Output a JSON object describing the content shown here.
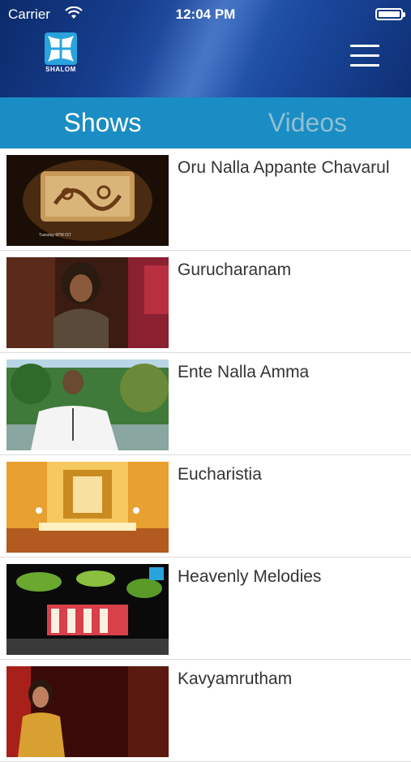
{
  "status_bar": {
    "carrier": "Carrier",
    "time": "12:04 PM"
  },
  "header": {
    "logo_text": "SHALOM"
  },
  "tabs": [
    {
      "label": "Shows",
      "active": true
    },
    {
      "label": "Videos",
      "active": false
    }
  ],
  "shows": [
    {
      "title": "Oru Nalla Appante Chavarul",
      "thumb_caption": "Tuesday 6PM IST"
    },
    {
      "title": "Gurucharanam"
    },
    {
      "title": "Ente Nalla Amma"
    },
    {
      "title": "Eucharistia"
    },
    {
      "title": "Heavenly Melodies"
    },
    {
      "title": "Kavyamrutham"
    }
  ],
  "colors": {
    "tab_bar": "#1a8dc4",
    "tab_inactive": "#8fbfd2",
    "header_blue": "#173e8e"
  }
}
